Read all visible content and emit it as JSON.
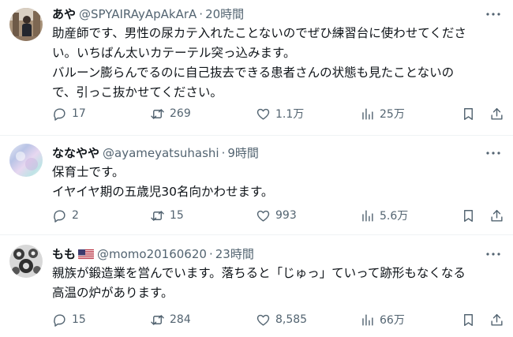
{
  "tweets": [
    {
      "display_name": "あや",
      "handle": "@SPYAIRAyApAkArA",
      "separator": "·",
      "time": "20時間",
      "lines": [
        "助産師です、男性の尿カテ入れたことないのでぜひ練習台に使わせてくださ",
        "い。いちばん太いカテーテル突っ込みます。",
        "バルーン膨らんでるのに自己抜去できる患者さんの状態も見たことないの",
        "で、引っこ抜かせてください。"
      ],
      "replies": "17",
      "reposts": "269",
      "likes": "1.1万",
      "views": "25万"
    },
    {
      "display_name": "ななやや",
      "handle": "@ayameyatsuhashi",
      "separator": "·",
      "time": "9時間",
      "lines": [
        "保育士です。",
        "イヤイヤ期の五歳児30名向かわせます。"
      ],
      "replies": "2",
      "reposts": "15",
      "likes": "993",
      "views": "5.6万"
    },
    {
      "display_name": "もも",
      "handle": "@momo20160620",
      "separator": "·",
      "time": "23時間",
      "lines": [
        "親族が鍛造業を営んでいます。落ちると「じゅっ」ていって跡形もなくなる",
        "高温の炉があります。"
      ],
      "replies": "15",
      "reposts": "284",
      "likes": "8,585",
      "views": "66万"
    }
  ],
  "icons": {
    "more": "more-dots-icon",
    "reply": "speech-bubble-icon",
    "repost": "repost-arrows-icon",
    "like": "heart-icon",
    "views": "bar-chart-icon",
    "bookmark": "bookmark-icon",
    "share": "share-upload-icon",
    "flag": "us-flag-icon"
  },
  "colors": {
    "text": "#0f1419",
    "secondary": "#536471",
    "divider": "#eff3f4"
  }
}
